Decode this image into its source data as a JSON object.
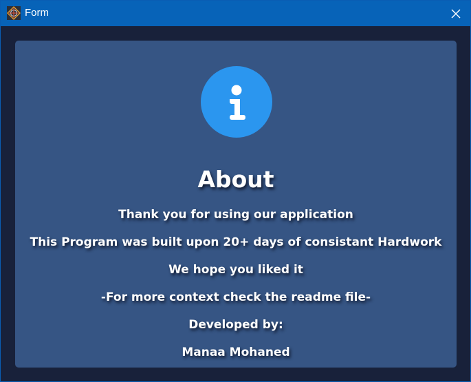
{
  "window": {
    "title": "Form",
    "app_icon": "app-logo-icon",
    "close_icon": "close-icon"
  },
  "colors": {
    "titlebar": "#0763b8",
    "frame": "#18213a",
    "panel": "#365584",
    "info_circle": "#2b96ef",
    "text": "#ffffff"
  },
  "about": {
    "icon": "info-icon",
    "heading": "About",
    "lines": [
      "Thank you for using our application",
      "This Program was built upon 20+ days of consistant Hardwork",
      "We hope you liked it",
      "-For more context check the readme file-",
      "Developed by:",
      "Manaa Mohaned"
    ]
  }
}
